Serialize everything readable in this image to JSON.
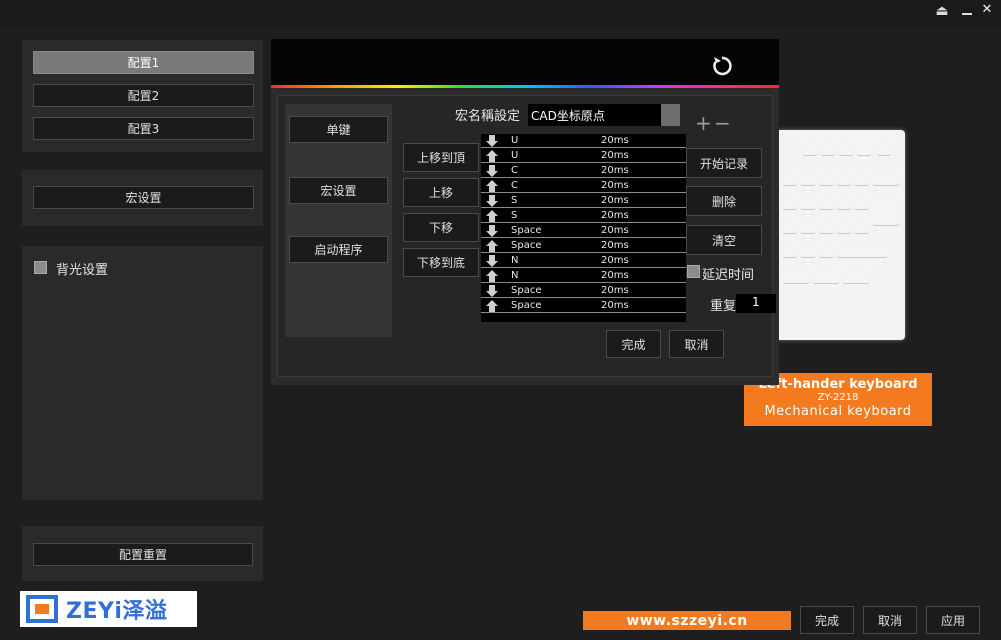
{
  "window_controls": {
    "eject": "⏏",
    "minimize": "–",
    "close": "✕"
  },
  "profiles": [
    "配置1",
    "配置2",
    "配置3"
  ],
  "macro_settings_label": "宏设置",
  "backlight_label": "背光设置",
  "reset_label": "配置重置",
  "brand": {
    "text": "ZEYi泽溢"
  },
  "macro": {
    "tabs": [
      "单键",
      "宏设置",
      "启动程序"
    ],
    "name_label": "宏名稱設定",
    "name_value": "CAD坐标原点",
    "plus": "+",
    "minus": "−",
    "move_buttons": [
      "上移到頂",
      "上移",
      "下移",
      "下移到底"
    ],
    "actions": [
      "开始记录",
      "删除",
      "清空"
    ],
    "delay_label": "延迟时间",
    "repeat_label": "重复",
    "repeat_value": "1",
    "done": "完成",
    "cancel": "取消",
    "events": [
      {
        "dir": "down",
        "key": "U",
        "delay": "20ms"
      },
      {
        "dir": "up",
        "key": "U",
        "delay": "20ms"
      },
      {
        "dir": "down",
        "key": "C",
        "delay": "20ms"
      },
      {
        "dir": "up",
        "key": "C",
        "delay": "20ms"
      },
      {
        "dir": "down",
        "key": "S",
        "delay": "20ms"
      },
      {
        "dir": "up",
        "key": "S",
        "delay": "20ms"
      },
      {
        "dir": "down",
        "key": "Space",
        "delay": "20ms"
      },
      {
        "dir": "up",
        "key": "Space",
        "delay": "20ms"
      },
      {
        "dir": "down",
        "key": "N",
        "delay": "20ms"
      },
      {
        "dir": "up",
        "key": "N",
        "delay": "20ms"
      },
      {
        "dir": "down",
        "key": "Space",
        "delay": "20ms"
      },
      {
        "dir": "up",
        "key": "Space",
        "delay": "20ms"
      }
    ]
  },
  "product": {
    "line1": "Left-hander keyboard",
    "line2": "ZY-2218",
    "line3": "Mechanical keyboard",
    "badge_color": "#f47a1f"
  },
  "website": "www.szzeyi.cn",
  "footer": {
    "done": "完成",
    "cancel": "取消",
    "apply": "应用"
  }
}
